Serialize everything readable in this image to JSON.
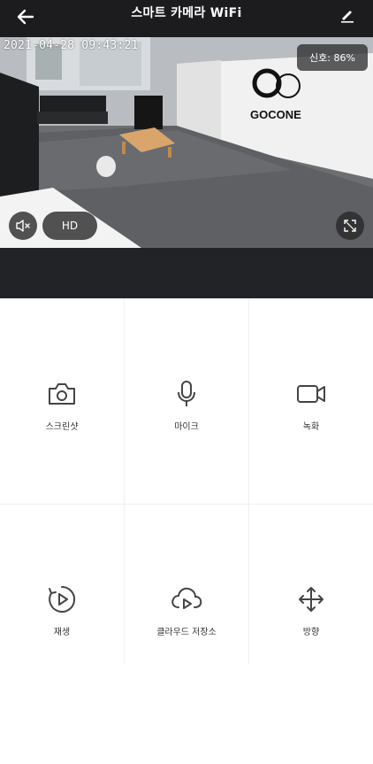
{
  "header": {
    "title": "스마트 카메라 WiFi",
    "back_icon": "arrow-left-icon",
    "edit_icon": "pencil-icon"
  },
  "video": {
    "timestamp": "2021-04-28 09:43:21",
    "signal_label": "신호: 86%",
    "quality_label": "HD",
    "logo_text": "GOCONE",
    "mute_icon": "speaker-muted-icon",
    "fullscreen_icon": "fullscreen-icon"
  },
  "controls": [
    {
      "label": "스크린샷",
      "icon": "camera-icon"
    },
    {
      "label": "마이크",
      "icon": "microphone-icon"
    },
    {
      "label": "녹화",
      "icon": "video-camera-icon"
    },
    {
      "label": "재생",
      "icon": "playback-icon"
    },
    {
      "label": "클라우드 저장소",
      "icon": "cloud-play-icon"
    },
    {
      "label": "방향",
      "icon": "move-arrows-icon"
    }
  ],
  "colors": {
    "header_bg": "#1c1c1e",
    "strip_bg": "#222326",
    "icon_stroke": "#444444"
  }
}
